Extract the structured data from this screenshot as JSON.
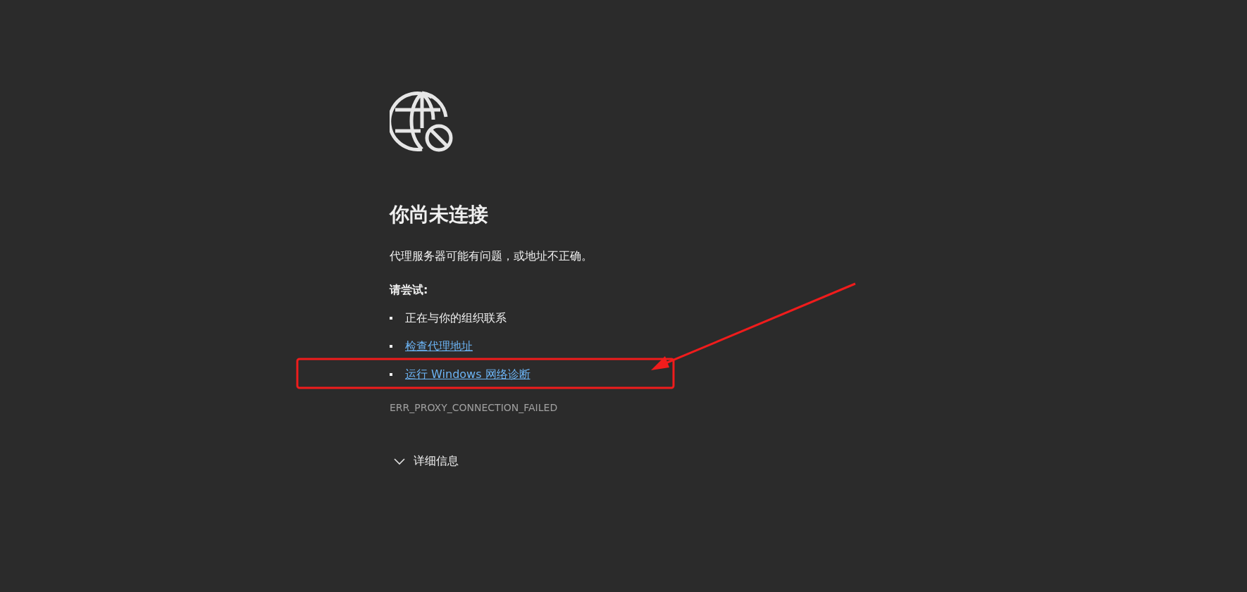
{
  "title": "你尚未连接",
  "message": "代理服务器可能有问题，或地址不正确。",
  "suggestions_heading": "请尝试:",
  "suggestions": [
    {
      "kind": "text",
      "label": "正在与你的组织联系"
    },
    {
      "kind": "link",
      "label": "检查代理地址"
    },
    {
      "kind": "link",
      "label": "运行 Windows 网络诊断"
    }
  ],
  "error_code": "ERR_PROXY_CONNECTION_FAILED",
  "details": {
    "label": "详细信息",
    "expanded": false
  }
}
